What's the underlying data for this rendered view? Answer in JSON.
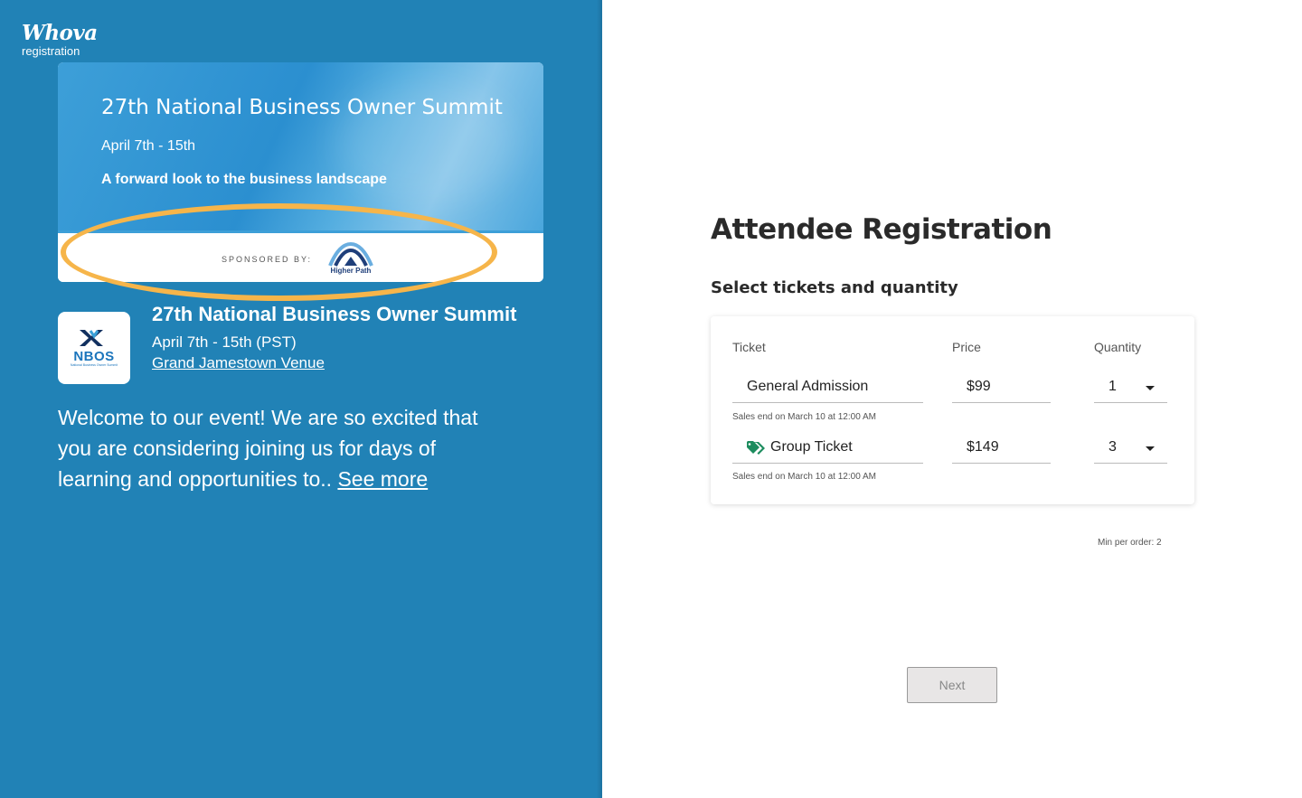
{
  "brand": {
    "name": "Whova",
    "sub": "registration"
  },
  "banner": {
    "title": "27th National Business Owner Summit",
    "date": "April 7th - 15th",
    "tagline": "A forward look to the business landscape",
    "sponsored_label": "SPONSORED BY:",
    "sponsor_name": "Higher Path"
  },
  "event": {
    "logo_text": "NBOS",
    "logo_subtext": "National Business Owner Summit",
    "title": "27th National Business Owner Summit",
    "date": "April 7th - 15th (PST)",
    "venue": "Grand Jamestown Venue",
    "welcome_text": "Welcome to our event! We are so excited that you are considering joining us for days of learning and opportunities to.. ",
    "see_more": "See more"
  },
  "registration": {
    "heading": "Attendee Registration",
    "subheading": "Select tickets and quantity",
    "columns": {
      "ticket": "Ticket",
      "price": "Price",
      "quantity": "Quantity"
    },
    "tickets": [
      {
        "name": "General Admission",
        "price": "$99",
        "quantity": "1",
        "note": "Sales end on March 10 at 12:00 AM",
        "icon": ""
      },
      {
        "name": "Group Ticket",
        "price": "$149",
        "quantity": "3",
        "note": "Sales end on March 10 at 12:00 AM",
        "icon": "tag-icon"
      }
    ],
    "min_per_order": "Min per order: 2",
    "next_label": "Next"
  },
  "colors": {
    "left_panel": "#2182b6",
    "highlight_ring": "#f6b54a",
    "tag_icon": "#1c8c5e",
    "button_bg": "#e8e6e6"
  }
}
